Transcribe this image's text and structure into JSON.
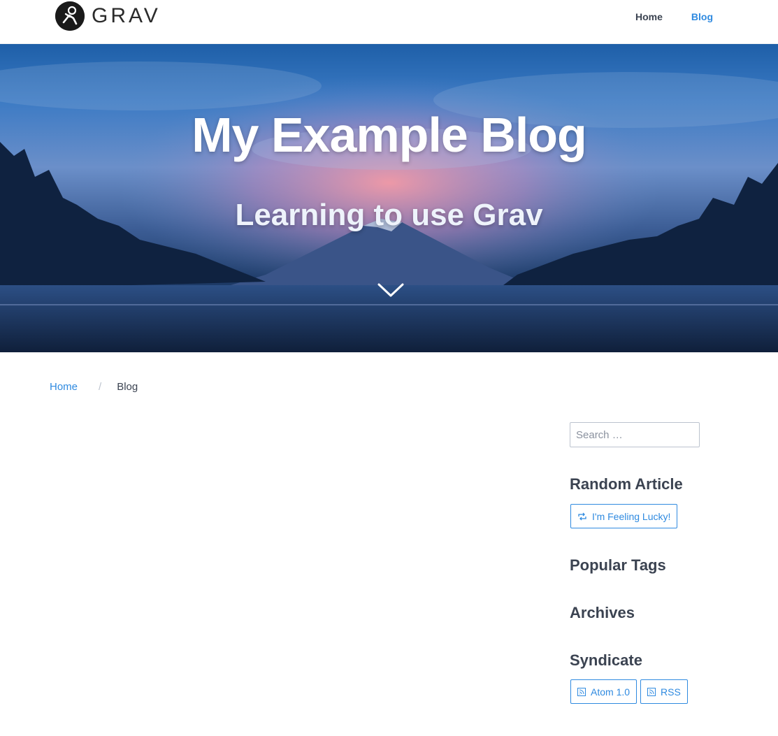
{
  "header": {
    "logo_text": "GRAV",
    "nav": [
      {
        "label": "Home",
        "active": false
      },
      {
        "label": "Blog",
        "active": true
      }
    ]
  },
  "hero": {
    "title": "My Example Blog",
    "subtitle": "Learning to use Grav",
    "scroll_icon": "chevron-down-icon"
  },
  "breadcrumb": {
    "home": "Home",
    "separator": "/",
    "current": "Blog"
  },
  "sidebar": {
    "search_placeholder": "Search …",
    "random_heading": "Random Article",
    "random_button": "I'm Feeling Lucky!",
    "tags_heading": "Popular Tags",
    "archives_heading": "Archives",
    "syndicate_heading": "Syndicate",
    "atom_button": "Atom 1.0",
    "rss_button": "RSS"
  },
  "colors": {
    "accent": "#2f8ae0",
    "text": "#3b4351",
    "hero_top": "#1e5fa8"
  }
}
